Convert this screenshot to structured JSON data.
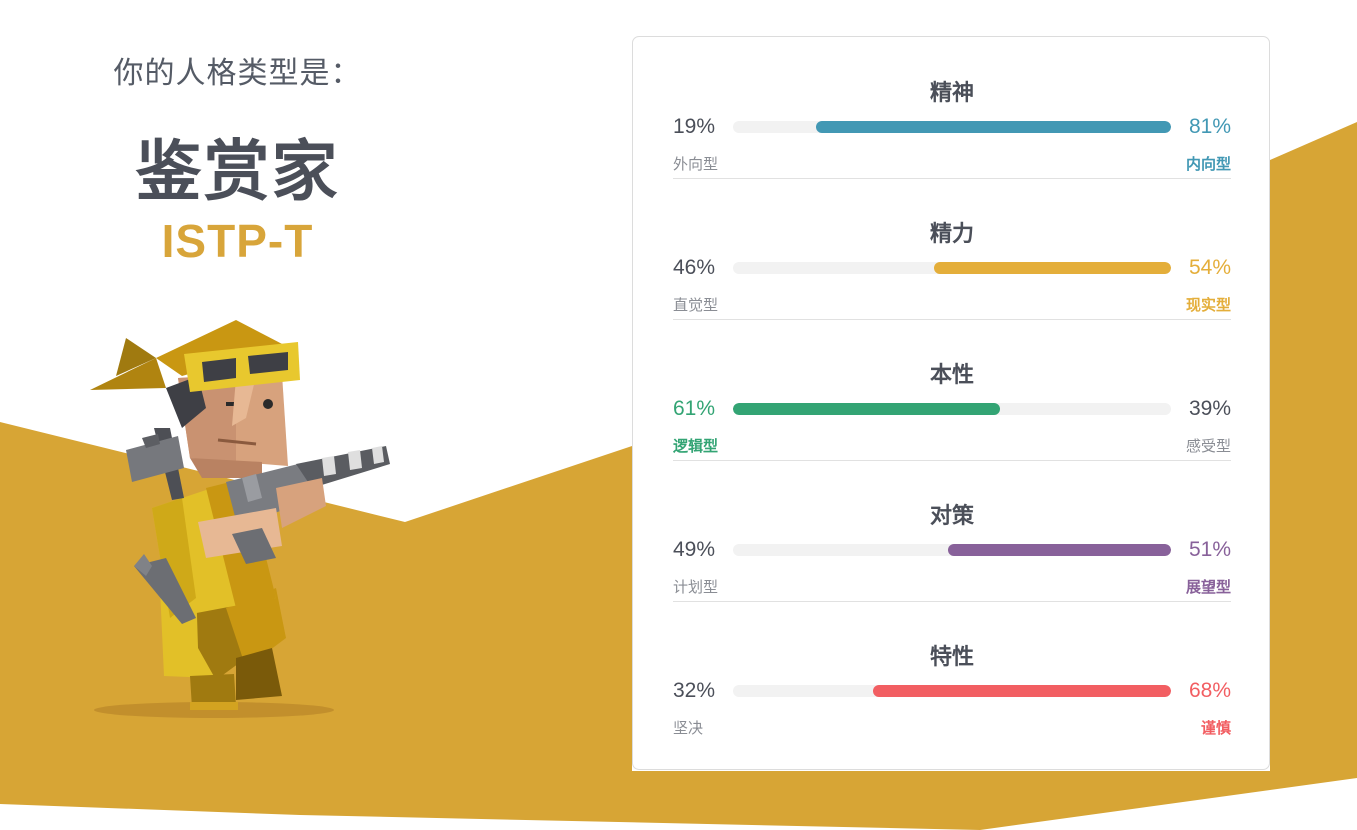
{
  "header": {
    "intro": "你的人格类型是：",
    "type_name": "鉴赏家",
    "type_code": "ISTP-T"
  },
  "colors": {
    "mind": "#4298b4",
    "energy": "#e4ae3a",
    "nature": "#33a474",
    "tactics": "#88619a",
    "identity": "#f25e62",
    "accent": "#d8a53a",
    "background_band": "#d7a535"
  },
  "traits": [
    {
      "title": "精神",
      "left_pct": "19%",
      "right_pct": "81%",
      "left_label": "外向型",
      "right_label": "内向型",
      "value": 81,
      "dominant": "right",
      "color": "#4298b4"
    },
    {
      "title": "精力",
      "left_pct": "46%",
      "right_pct": "54%",
      "left_label": "直觉型",
      "right_label": "现实型",
      "value": 54,
      "dominant": "right",
      "color": "#e4ae3a"
    },
    {
      "title": "本性",
      "left_pct": "61%",
      "right_pct": "39%",
      "left_label": "逻辑型",
      "right_label": "感受型",
      "value": 61,
      "dominant": "left",
      "color": "#33a474"
    },
    {
      "title": "对策",
      "left_pct": "49%",
      "right_pct": "51%",
      "left_label": "计划型",
      "right_label": "展望型",
      "value": 51,
      "dominant": "right",
      "color": "#88619a"
    },
    {
      "title": "特性",
      "left_pct": "32%",
      "right_pct": "68%",
      "left_label": "坚决",
      "right_label": "谨慎",
      "value": 68,
      "dominant": "right",
      "color": "#f25e62"
    }
  ],
  "illustration": {
    "icon": "virtuoso-character-illustration"
  }
}
